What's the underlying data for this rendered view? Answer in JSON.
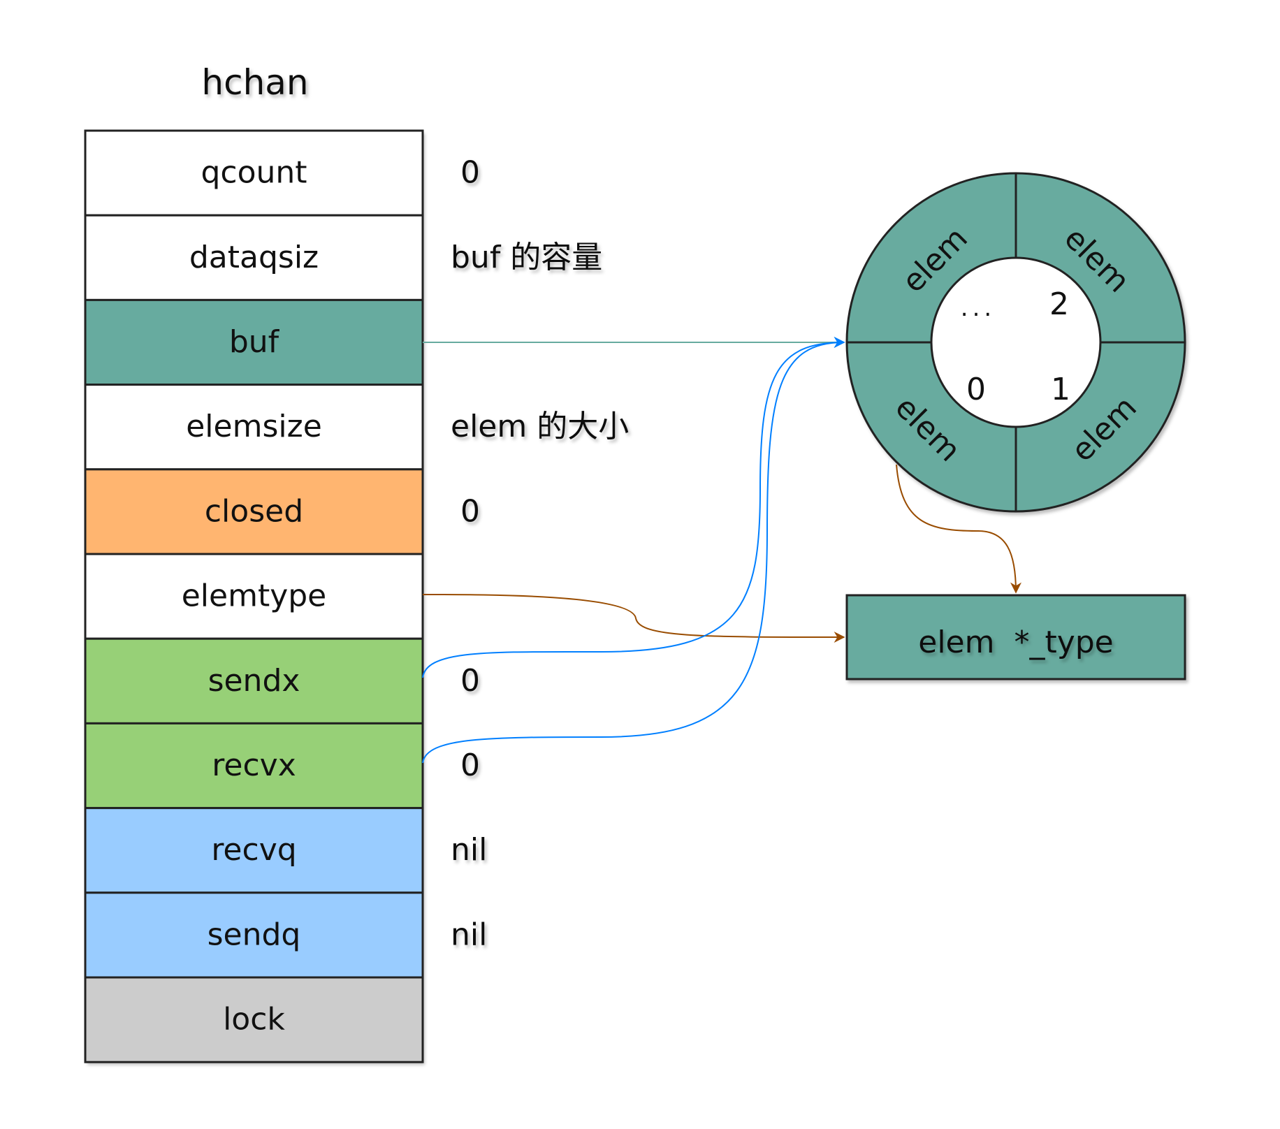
{
  "struct": {
    "title": "hchan",
    "fields": [
      {
        "name": "qcount",
        "value": "0",
        "color": "#ffffff"
      },
      {
        "name": "dataqsiz",
        "value": "buf 的容量",
        "color": "#ffffff"
      },
      {
        "name": "buf",
        "value": "",
        "color": "#67ab9f"
      },
      {
        "name": "elemsize",
        "value": "elem 的大小",
        "color": "#ffffff"
      },
      {
        "name": "closed",
        "value": "0",
        "color": "#ffb570"
      },
      {
        "name": "elemtype",
        "value": "",
        "color": "#ffffff"
      },
      {
        "name": "sendx",
        "value": "0",
        "color": "#97d077"
      },
      {
        "name": "recvx",
        "value": "0",
        "color": "#97d077"
      },
      {
        "name": "recvq",
        "value": "nil",
        "color": "#99ccff"
      },
      {
        "name": "sendq",
        "value": "nil",
        "color": "#99ccff"
      },
      {
        "name": "lock",
        "value": "",
        "color": "#cccccc"
      }
    ]
  },
  "ring": {
    "color": "#67ab9f",
    "segments": [
      "elem",
      "elem",
      "elem",
      "elem"
    ],
    "indices": [
      "...",
      "2",
      "0",
      "1"
    ]
  },
  "type_box": {
    "label": "elem  *_type",
    "color": "#67ab9f"
  },
  "arrow_colors": {
    "buf": "#67ab9f",
    "elemtype": "#994c00",
    "index": "#007fff"
  }
}
